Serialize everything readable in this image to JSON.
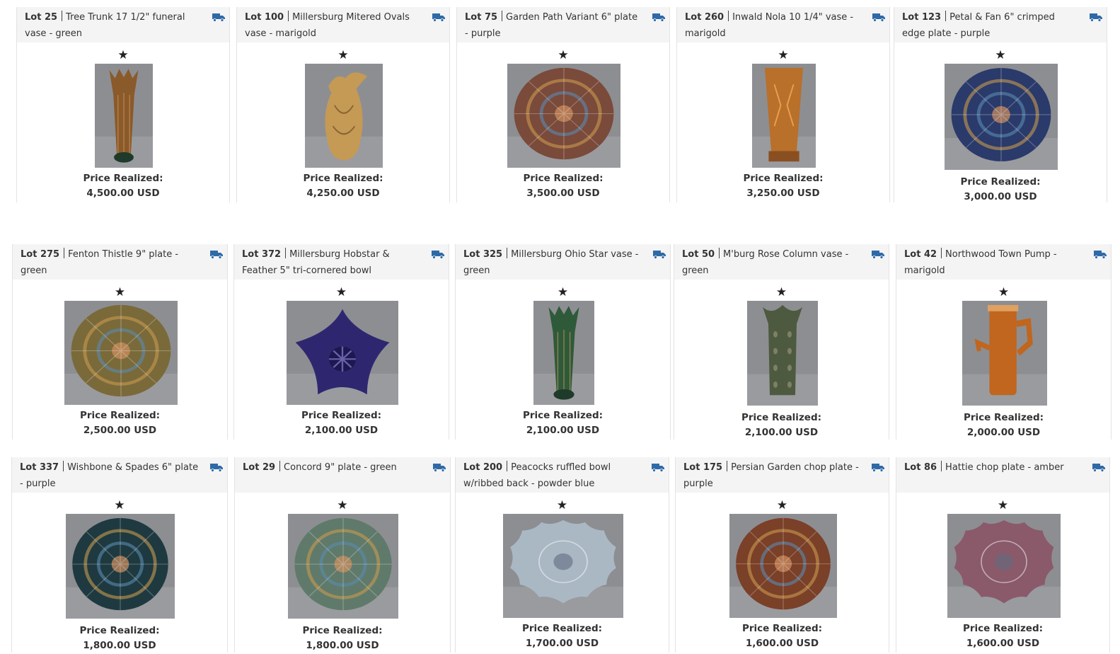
{
  "star_glyph": "★",
  "price_label": "Price Realized:",
  "lots": [
    {
      "lot": "Lot 25",
      "title": "Tree Trunk 17 1/2\" funeral vase - green",
      "price": "4,500.00 USD",
      "shape": "tall-vase",
      "color": "#8a5a2a"
    },
    {
      "lot": "Lot 100",
      "title": "Millersburg Mitered Ovals vase - marigold",
      "price": "4,250.00 USD",
      "shape": "pitcher-vase",
      "color": "#c59a55"
    },
    {
      "lot": "Lot 75",
      "title": "Garden Path Variant 6\" plate - purple",
      "price": "3,500.00 USD",
      "shape": "plate",
      "color": "#7a4a3a"
    },
    {
      "lot": "Lot 260",
      "title": "Inwald Nola 10 1/4\" vase - marigold",
      "price": "3,250.00 USD",
      "shape": "square-vase",
      "color": "#b8702a"
    },
    {
      "lot": "Lot 123",
      "title": "Petal & Fan 6\" crimped edge plate - purple",
      "price": "3,000.00 USD",
      "shape": "plate",
      "color": "#2a3a6a"
    },
    {
      "lot": "Lot 275",
      "title": "Fenton Thistle 9\" plate - green",
      "price": "2,500.00 USD",
      "shape": "plate",
      "color": "#7a6a3a"
    },
    {
      "lot": "Lot 372",
      "title": "Millersburg Hobstar & Feather 5\" tri-cornered bowl",
      "price": "2,100.00 USD",
      "shape": "tri-bowl",
      "color": "#2e2770"
    },
    {
      "lot": "Lot 325",
      "title": "Millersburg Ohio Star vase - green",
      "price": "2,100.00 USD",
      "shape": "tall-vase",
      "color": "#2f5a3a"
    },
    {
      "lot": "Lot 50",
      "title": "M'burg Rose Column vase - green",
      "price": "2,100.00 USD",
      "shape": "column-vase",
      "color": "#4e5a40"
    },
    {
      "lot": "Lot 42",
      "title": "Northwood Town Pump - marigold",
      "price": "2,000.00 USD",
      "shape": "pump",
      "color": "#c0661f"
    },
    {
      "lot": "Lot 337",
      "title": "Wishbone & Spades 6\" plate - purple",
      "price": "1,800.00 USD",
      "shape": "plate",
      "color": "#1e3a40"
    },
    {
      "lot": "Lot 29",
      "title": "Concord 9\" plate - green",
      "price": "1,800.00 USD",
      "shape": "plate",
      "color": "#5f7a6a"
    },
    {
      "lot": "Lot 200",
      "title": "Peacocks ruffled bowl w/ribbed back - powder blue",
      "price": "1,700.00 USD",
      "shape": "ruffled-bowl",
      "color": "#aab8c4"
    },
    {
      "lot": "Lot 175",
      "title": "Persian Garden chop plate - purple",
      "price": "1,600.00 USD",
      "shape": "plate",
      "color": "#7a4028"
    },
    {
      "lot": "Lot 86",
      "title": "Hattie chop plate - amber",
      "price": "1,600.00 USD",
      "shape": "ruffled-bowl",
      "color": "#8a5a6a"
    }
  ]
}
